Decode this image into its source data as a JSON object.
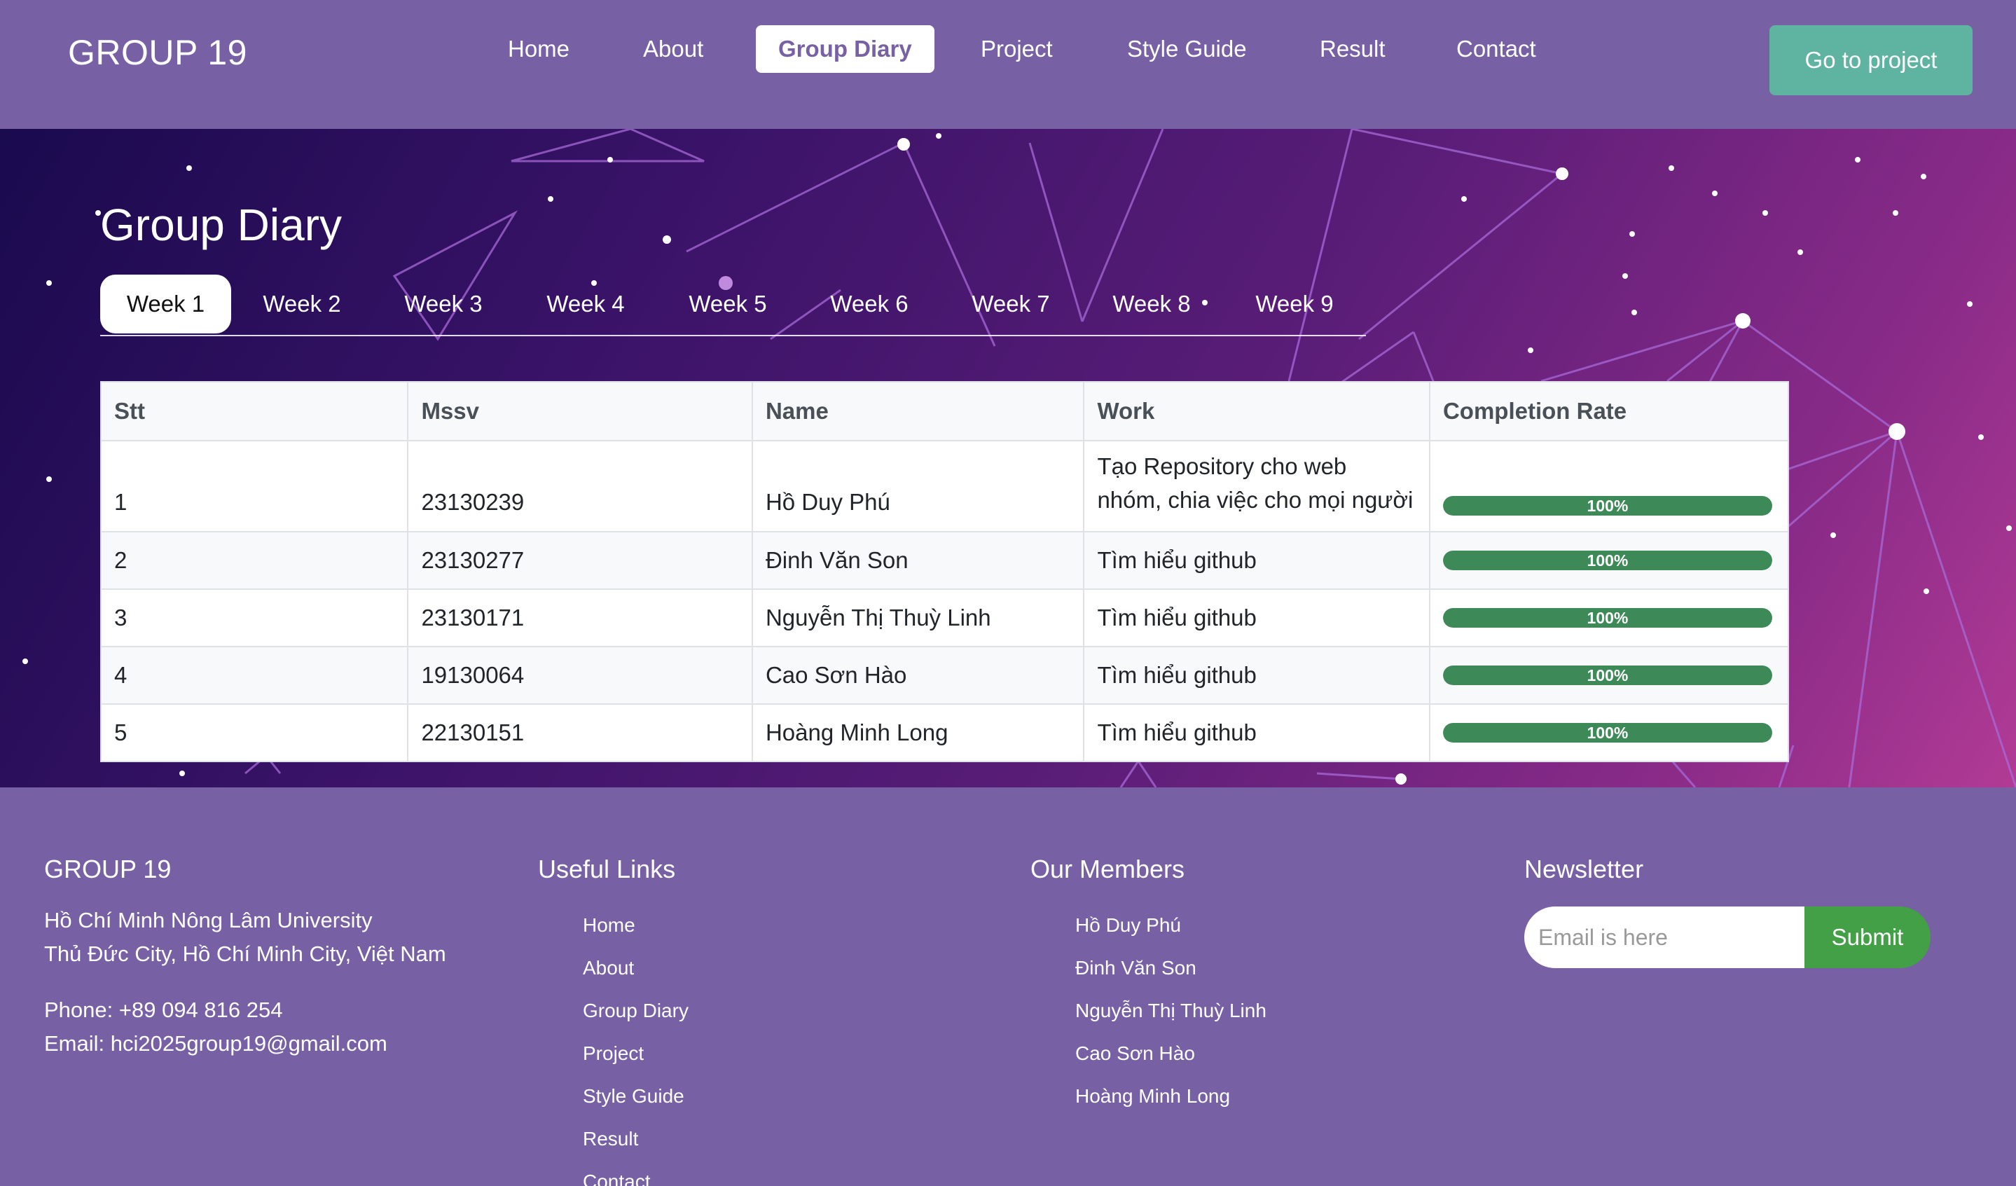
{
  "brand": "GROUP 19",
  "nav": {
    "items": [
      "Home",
      "About",
      "Group Diary",
      "Project",
      "Style Guide",
      "Result",
      "Contact"
    ],
    "active": "Group Diary",
    "cta": "Go to project"
  },
  "page": {
    "title": "Group Diary",
    "tabs": [
      "Week 1",
      "Week 2",
      "Week 3",
      "Week 4",
      "Week 5",
      "Week 6",
      "Week 7",
      "Week 8",
      "Week 9"
    ],
    "active_tab": "Week 1"
  },
  "table": {
    "headers": [
      "Stt",
      "Mssv",
      "Name",
      "Work",
      "Completion Rate"
    ],
    "rows": [
      {
        "stt": "1",
        "mssv": "23130239",
        "name": "Hồ Duy Phú",
        "work": "Tạo Repository cho web nhóm, chia việc cho mọi người",
        "rate": "100%",
        "rate_value": 100
      },
      {
        "stt": "2",
        "mssv": "23130277",
        "name": "Đinh Văn Son",
        "work": "Tìm hiểu github",
        "rate": "100%",
        "rate_value": 100
      },
      {
        "stt": "3",
        "mssv": "23130171",
        "name": "Nguyễn Thị Thuỳ Linh",
        "work": "Tìm hiểu github",
        "rate": "100%",
        "rate_value": 100
      },
      {
        "stt": "4",
        "mssv": "19130064",
        "name": "Cao Sơn Hào",
        "work": "Tìm hiểu github",
        "rate": "100%",
        "rate_value": 100
      },
      {
        "stt": "5",
        "mssv": "22130151",
        "name": "Hoàng Minh Long",
        "work": "Tìm hiểu github",
        "rate": "100%",
        "rate_value": 100
      }
    ]
  },
  "footer": {
    "about": {
      "heading": "GROUP 19",
      "line1": "Hồ Chí Minh Nông Lâm University",
      "line2": "Thủ Đức City, Hồ Chí Minh City, Việt Nam",
      "phone": "Phone: +89 094 816 254",
      "email": "Email: hci2025group19@gmail.com"
    },
    "links": {
      "heading": "Useful Links",
      "items": [
        "Home",
        "About",
        "Group Diary",
        "Project",
        "Style Guide",
        "Result",
        "Contact"
      ]
    },
    "members": {
      "heading": "Our Members",
      "items": [
        "Hồ Duy Phú",
        "Đinh Văn Son",
        "Nguyễn Thị Thuỳ Linh",
        "Cao Sơn Hào",
        "Hoàng Minh Long"
      ]
    },
    "newsletter": {
      "heading": "Newsletter",
      "placeholder": "Email is here",
      "button": "Submit"
    }
  },
  "colors": {
    "nav_bg": "#7760a4",
    "cta_bg": "#5fb3a1",
    "progress": "#3d8a58",
    "submit": "#43a047"
  }
}
